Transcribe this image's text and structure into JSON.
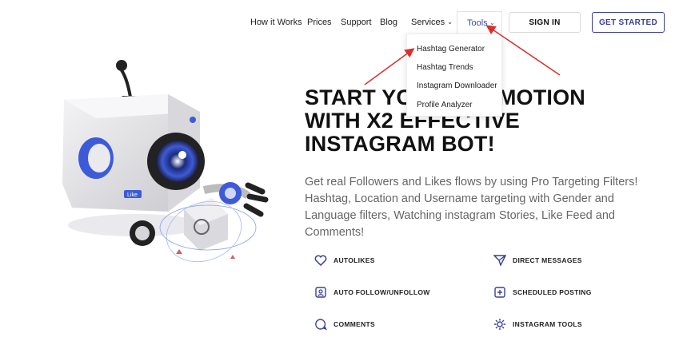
{
  "nav": {
    "links": [
      "How it Works",
      "Prices",
      "Support",
      "Blog",
      "Services"
    ],
    "tools_label": "Tools",
    "signin_label": "SIGN IN",
    "get_started_label": "GET STARTED"
  },
  "tools_menu": {
    "items": [
      "Hashtag Generator",
      "Hashtag Trends",
      "Instagram Downloader",
      "Profile Analyzer"
    ]
  },
  "hero": {
    "headline_line1": "START YOUR PROMOTION",
    "headline_line2": "WITH X2 EFFECTIVE",
    "headline_line3": "INSTAGRAM BOT!",
    "description": "Get real Followers and Likes flows by using Pro Targeting Filters! Hashtag, Location and Username targeting with Gender and Language filters, Watching instagram Stories, Like Feed and Comments!",
    "robot_badge": "Like"
  },
  "features": [
    {
      "label": "AUTOLIKES",
      "icon": "heart-icon"
    },
    {
      "label": "DIRECT MESSAGES",
      "icon": "send-icon"
    },
    {
      "label": "AUTO FOLLOW/UNFOLLOW",
      "icon": "follow-icon"
    },
    {
      "label": "SCHEDULED POSTING",
      "icon": "plus-square-icon"
    },
    {
      "label": "COMMENTS",
      "icon": "comment-icon"
    },
    {
      "label": "INSTAGRAM TOOLS",
      "icon": "gear-icon"
    }
  ],
  "colors": {
    "accent": "#3a3f95",
    "annotation_arrow": "#d9302c"
  }
}
